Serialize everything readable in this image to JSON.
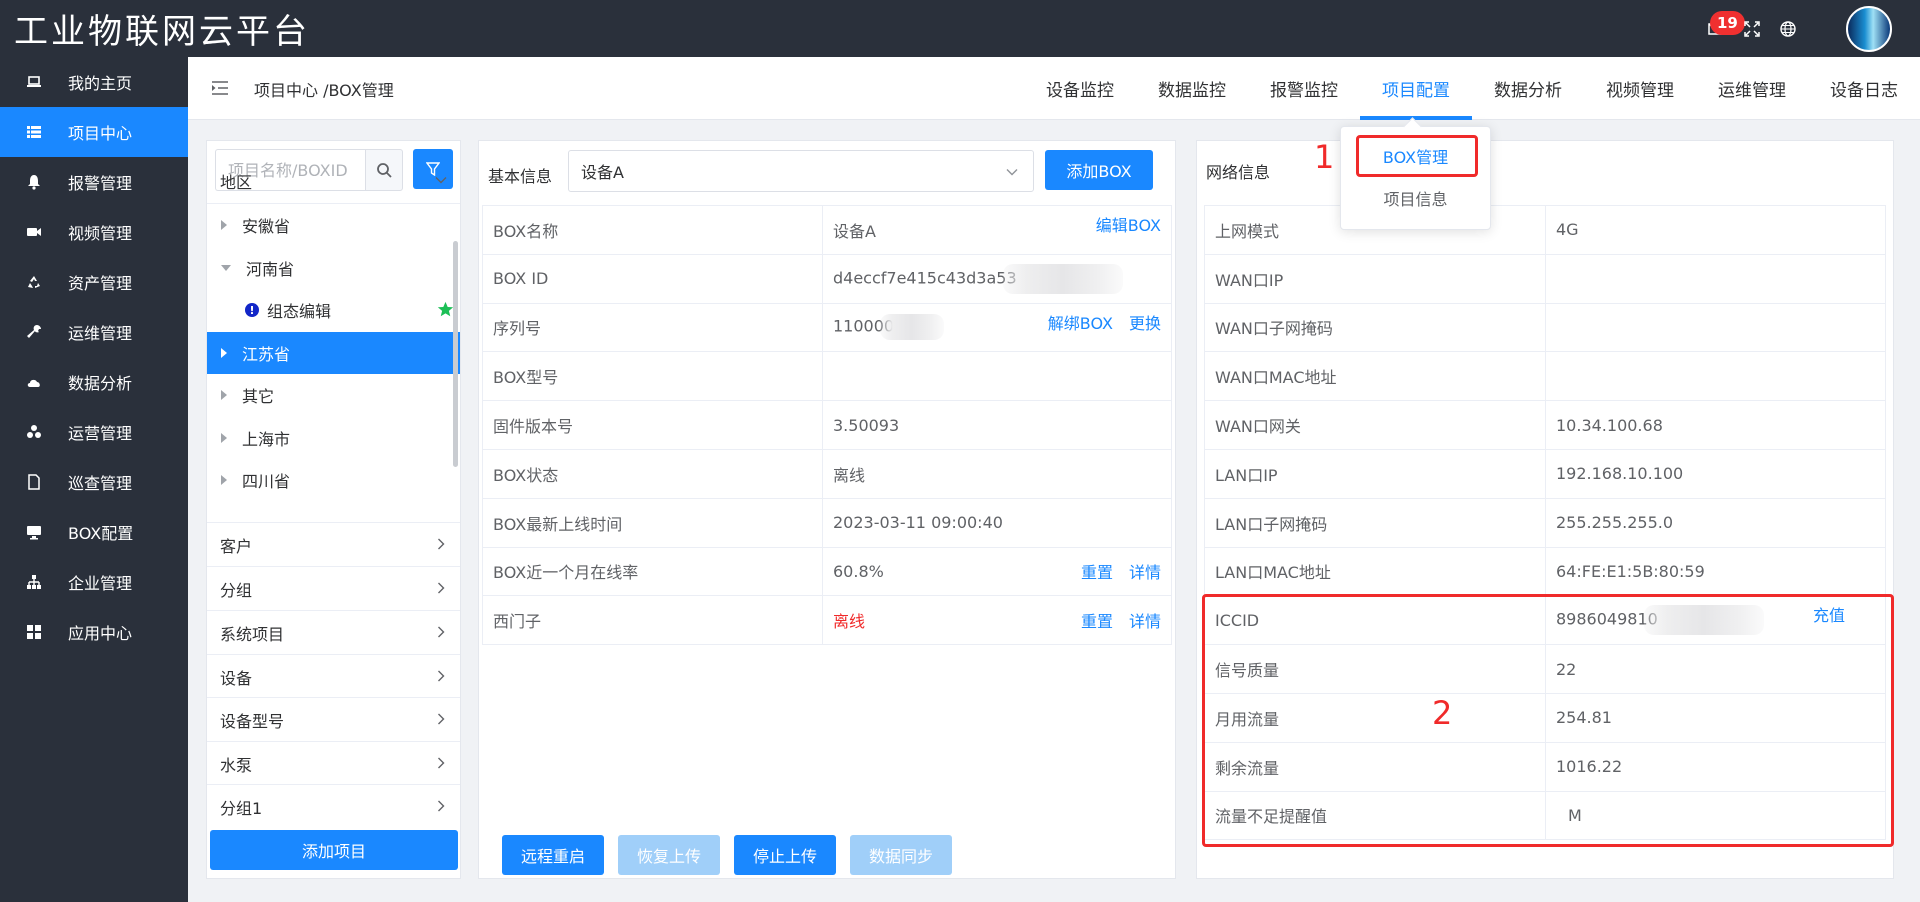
{
  "app": {
    "title": "工业物联网云平台",
    "badge_count": "19"
  },
  "sidebar": {
    "items": [
      {
        "label": "我的主页",
        "icon": "laptop-icon"
      },
      {
        "label": "项目中心",
        "icon": "list-icon",
        "active": true
      },
      {
        "label": "报警管理",
        "icon": "bell-icon"
      },
      {
        "label": "视频管理",
        "icon": "video-icon"
      },
      {
        "label": "资产管理",
        "icon": "recycle-icon"
      },
      {
        "label": "运维管理",
        "icon": "wrench-icon"
      },
      {
        "label": "数据分析",
        "icon": "cloud-chart-icon"
      },
      {
        "label": "运营管理",
        "icon": "cubes-icon"
      },
      {
        "label": "巡查管理",
        "icon": "file-icon"
      },
      {
        "label": "BOX配置",
        "icon": "desktop-icon"
      },
      {
        "label": "企业管理",
        "icon": "sitemap-icon"
      },
      {
        "label": "应用中心",
        "icon": "grid-icon"
      }
    ]
  },
  "header": {
    "breadcrumb": "项目中心 /BOX管理",
    "nav": [
      "设备监控",
      "数据监控",
      "报警监控",
      "项目配置",
      "数据分析",
      "视频管理",
      "运维管理",
      "设备日志"
    ],
    "active_nav": "项目配置"
  },
  "dropdown": {
    "items": [
      "BOX管理",
      "项目信息"
    ]
  },
  "left": {
    "search_placeholder": "项目名称/BOXID",
    "region_header": "地区",
    "tree": [
      {
        "label": "安徽省",
        "level": 1,
        "caret": "right"
      },
      {
        "label": "河南省",
        "level": 1,
        "caret": "down"
      },
      {
        "label": "组态编辑",
        "level": 2,
        "caret": "none"
      },
      {
        "label": "江苏省",
        "level": 1,
        "caret": "right",
        "selected": true
      },
      {
        "label": "其它",
        "level": 1,
        "caret": "right"
      },
      {
        "label": "上海市",
        "level": 1,
        "caret": "right"
      },
      {
        "label": "四川省",
        "level": 1,
        "caret": "right"
      }
    ],
    "groups": [
      "客户",
      "分组",
      "系统项目",
      "设备",
      "设备型号",
      "水泵",
      "分组1"
    ],
    "add_button": "添加项目"
  },
  "middle": {
    "basic_label": "基本信息",
    "selected_device": "设备A",
    "add_box_button": "添加BOX",
    "rows": [
      {
        "key": "BOX名称",
        "value": "设备A",
        "actions": [
          "编辑BOX"
        ]
      },
      {
        "key": "BOX ID",
        "value": "d4eccf7e415c43d3a53",
        "blurred": true
      },
      {
        "key": "序列号",
        "value": "110000",
        "blurred": true,
        "actions": [
          "解绑BOX",
          "更换"
        ]
      },
      {
        "key": "BOX型号",
        "value": ""
      },
      {
        "key": "固件版本号",
        "value": "3.50093"
      },
      {
        "key": "BOX状态",
        "value": "离线",
        "red": true
      },
      {
        "key": "BOX最新上线时间",
        "value": "2023-03-11 09:00:40"
      },
      {
        "key": "BOX近一个月在线率",
        "value": "60.8%",
        "actions": [
          "重置",
          "详情"
        ]
      },
      {
        "key": "西门子",
        "value": "离线",
        "red": true,
        "actions": [
          "重置",
          "详情"
        ]
      }
    ],
    "bottom_buttons": [
      {
        "label": "远程重启",
        "enabled": true
      },
      {
        "label": "恢复上传",
        "enabled": false
      },
      {
        "label": "停止上传",
        "enabled": true
      },
      {
        "label": "数据同步",
        "enabled": false
      }
    ]
  },
  "right": {
    "net_label": "网络信息",
    "rows": [
      {
        "key": "上网模式",
        "value": "4G"
      },
      {
        "key": "WAN口IP",
        "value": ""
      },
      {
        "key": "WAN口子网掩码",
        "value": ""
      },
      {
        "key": "WAN口MAC地址",
        "value": ""
      },
      {
        "key": "WAN口网关",
        "value": "10.34.100.68"
      },
      {
        "key": "LAN口IP",
        "value": "192.168.10.100"
      },
      {
        "key": "LAN口子网掩码",
        "value": "255.255.255.0"
      },
      {
        "key": "LAN口MAC地址",
        "value": "64:FE:E1:5B:80:59"
      },
      {
        "key": "ICCID",
        "value": "8986049810",
        "blurred": true,
        "actions": [
          "充值"
        ]
      },
      {
        "key": "信号质量",
        "value": "22"
      },
      {
        "key": "月用流量",
        "value": "254.81"
      },
      {
        "key": "剩余流量",
        "value": "1016.22"
      },
      {
        "key": "流量不足提醒值",
        "value": "M",
        "link_key": true,
        "link_value": true
      }
    ]
  },
  "annotations": {
    "n1": "1",
    "n2": "2"
  },
  "colors": {
    "accent": "#1a88ff",
    "sidebar_bg": "#2a303b",
    "danger": "#f02a2a"
  }
}
